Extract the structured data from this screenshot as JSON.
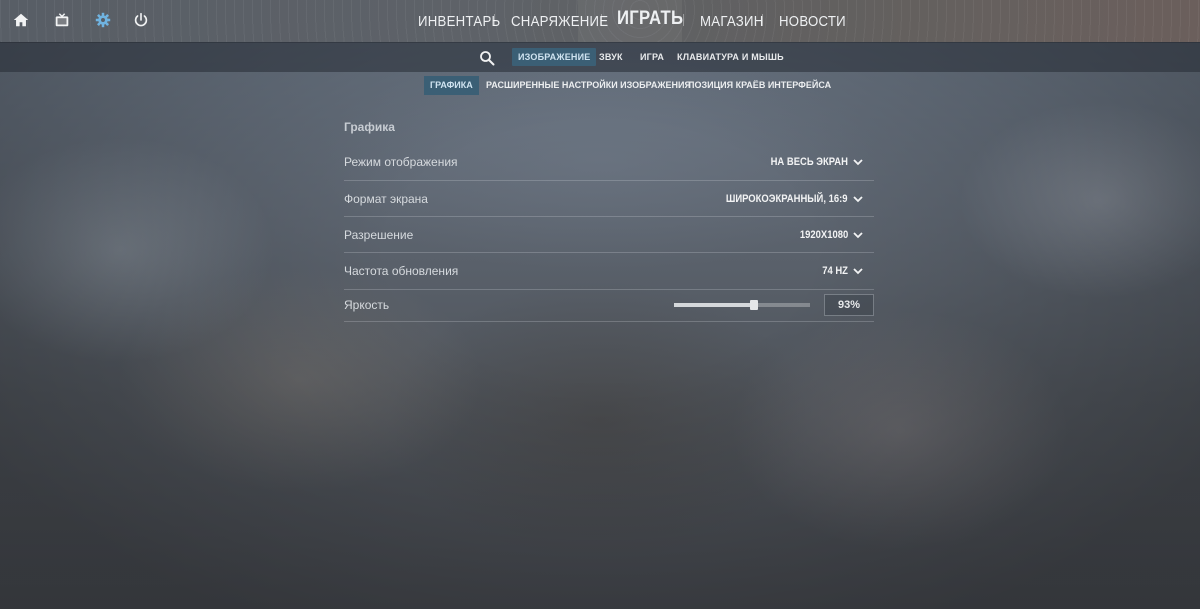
{
  "top_nav": {
    "left_icons": [
      {
        "icon": "home-icon"
      },
      {
        "icon": "tv-icon"
      },
      {
        "icon": "gear-icon",
        "active": true
      },
      {
        "icon": "power-icon"
      }
    ],
    "items": [
      {
        "label": "ИНВЕНТАРЬ"
      },
      {
        "label": "СНАРЯЖЕНИЕ"
      },
      {
        "label": "ИГРАТЬ"
      },
      {
        "label": "МАГАЗИН"
      },
      {
        "label": "НОВОСТИ"
      }
    ]
  },
  "settings_nav": {
    "search_icon": "search-icon",
    "items": [
      {
        "label": "ИЗОБРАЖЕНИЕ",
        "active": true
      },
      {
        "label": "ЗВУК"
      },
      {
        "label": "ИГРА"
      },
      {
        "label": "КЛАВИАТУРА И МЫШЬ"
      }
    ]
  },
  "sub_tabs": [
    {
      "label": "ГРАФИКА",
      "active": true
    },
    {
      "label": "РАСШИРЕННЫЕ НАСТРОЙКИ ИЗОБРАЖЕНИЯ"
    },
    {
      "label": "ПОЗИЦИЯ КРАЁВ ИНТЕРФЕЙСА"
    }
  ],
  "graphics": {
    "section_title": "Графика",
    "rows": [
      {
        "label": "Режим отображения",
        "value": "НА ВЕСЬ ЭКРАН"
      },
      {
        "label": "Формат экрана",
        "value": "ШИРОКОЭКРАННЫЙ, 16:9"
      },
      {
        "label": "Разрешение",
        "value": "1920X1080"
      },
      {
        "label": "Частота обновления",
        "value": "74 HZ"
      }
    ],
    "brightness": {
      "label": "Яркость",
      "value_text": "93%",
      "slider_fraction": 0.59
    }
  },
  "colors": {
    "accent_active": "#3b5f75",
    "active_icon": "#6fb3e0"
  }
}
